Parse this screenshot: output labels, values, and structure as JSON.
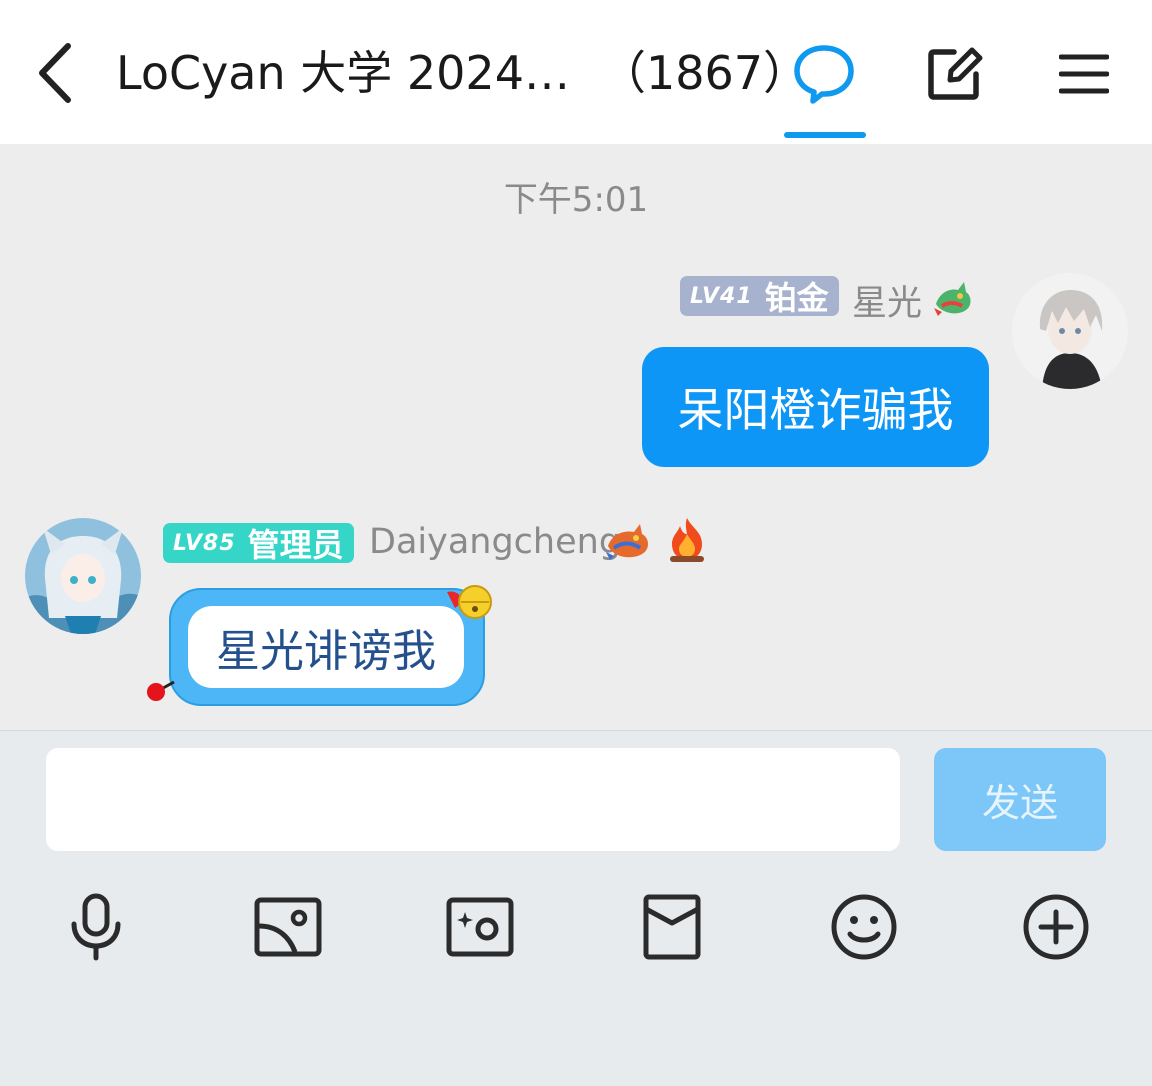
{
  "header": {
    "title": "LoCyan 大学 2024…",
    "member_count": "（1867）"
  },
  "chat": {
    "timestamp": "下午5:01",
    "messages": [
      {
        "direction": "outgoing",
        "level": "LV41",
        "role": "铂金",
        "sender": "星光",
        "text": "呆阳橙诈骗我",
        "badge_color": "#a7b3ce"
      },
      {
        "direction": "incoming",
        "level": "LV85",
        "role": "管理员",
        "sender": "Daiyangcheng",
        "text": "星光诽谤我",
        "badge_color": "#35d5c8"
      }
    ]
  },
  "input": {
    "placeholder": "",
    "value": "",
    "send_label": "发送"
  },
  "toolbar": [
    "mic-icon",
    "image-icon",
    "camera-icon",
    "red-packet-icon",
    "emoji-icon",
    "plus-icon"
  ],
  "colors": {
    "accent": "#0f9aef",
    "outgoing_bubble": "#0d96f5",
    "send_button": "#7cc7f7"
  }
}
